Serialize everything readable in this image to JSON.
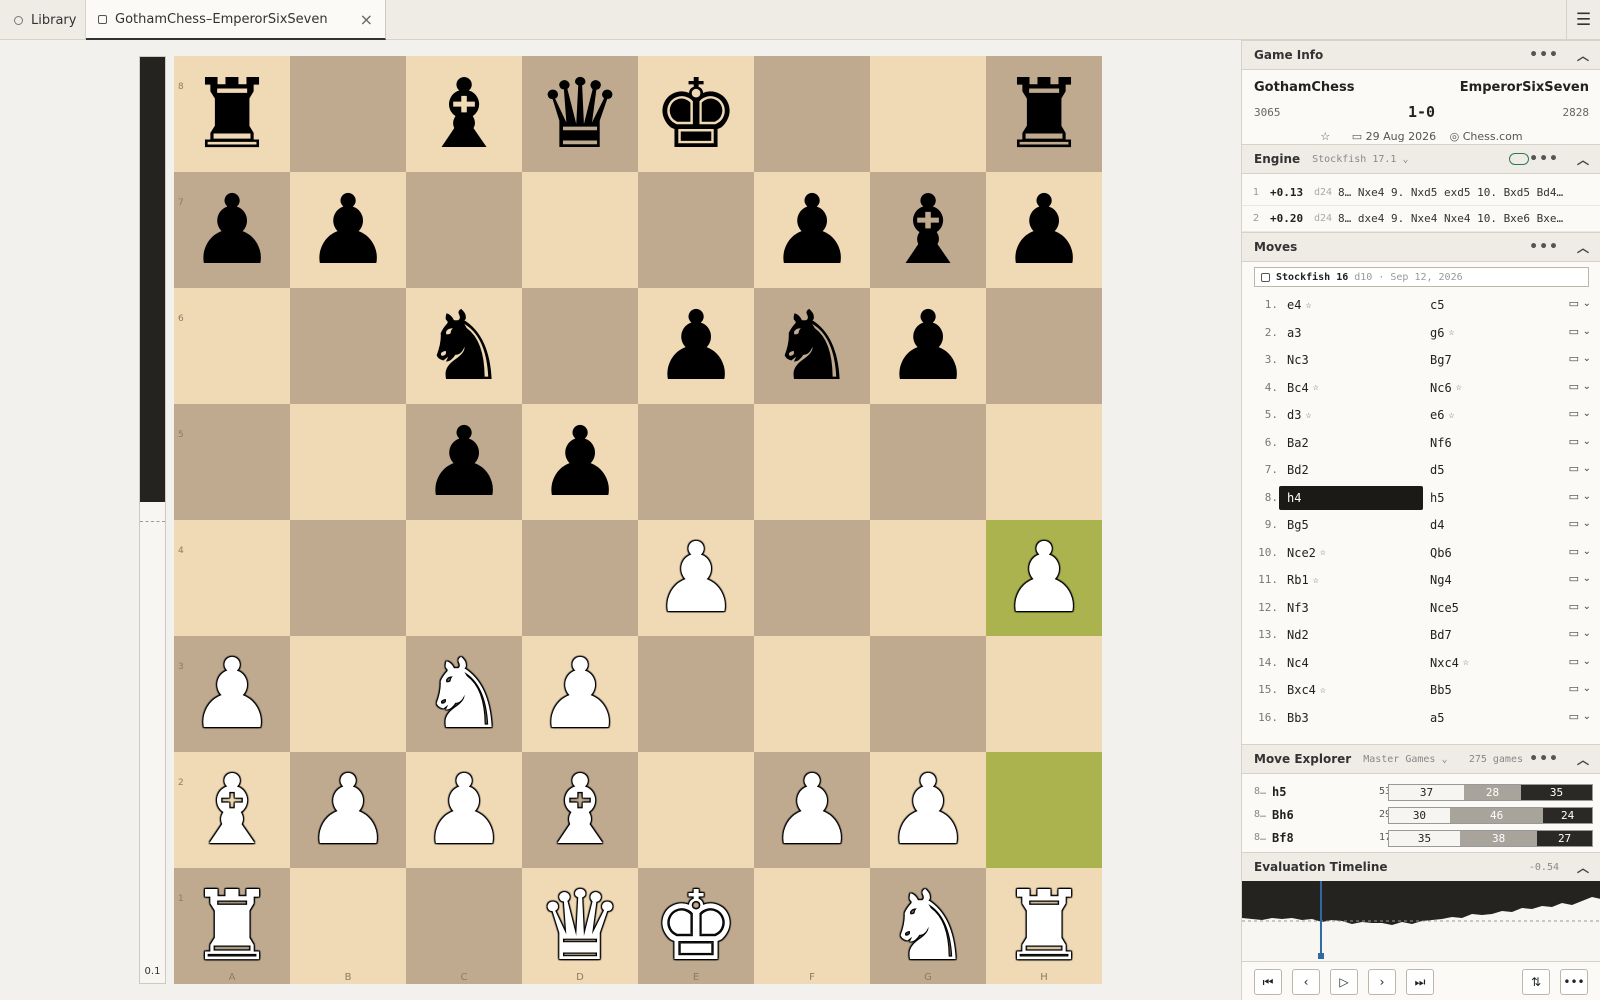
{
  "tabs": {
    "library_label": "Library",
    "game_label": "GothamChess–EmperorSixSeven"
  },
  "eval_bar": {
    "value": "0.1",
    "black_fraction": 0.48
  },
  "board": {
    "rank_labels": [
      "8",
      "7",
      "6",
      "5",
      "4",
      "3",
      "2",
      "1"
    ],
    "file_labels": [
      "A",
      "B",
      "C",
      "D",
      "E",
      "F",
      "G",
      "H"
    ],
    "highlight_squares": [
      "h4",
      "h2"
    ],
    "pieces": [
      {
        "sq": "a8",
        "glyph": "♜",
        "color": "black"
      },
      {
        "sq": "c8",
        "glyph": "♝",
        "color": "black"
      },
      {
        "sq": "d8",
        "glyph": "♛",
        "color": "black"
      },
      {
        "sq": "e8",
        "glyph": "♚",
        "color": "black"
      },
      {
        "sq": "h8",
        "glyph": "♜",
        "color": "black"
      },
      {
        "sq": "a7",
        "glyph": "♟",
        "color": "black"
      },
      {
        "sq": "b7",
        "glyph": "♟",
        "color": "black"
      },
      {
        "sq": "f7",
        "glyph": "♟",
        "color": "black"
      },
      {
        "sq": "g7",
        "glyph": "♝",
        "color": "black"
      },
      {
        "sq": "h7",
        "glyph": "♟",
        "color": "black"
      },
      {
        "sq": "c6",
        "glyph": "♞",
        "color": "black"
      },
      {
        "sq": "e6",
        "glyph": "♟",
        "color": "black"
      },
      {
        "sq": "f6",
        "glyph": "♞",
        "color": "black"
      },
      {
        "sq": "g6",
        "glyph": "♟",
        "color": "black"
      },
      {
        "sq": "c5",
        "glyph": "♟",
        "color": "black"
      },
      {
        "sq": "d5",
        "glyph": "♟",
        "color": "black"
      },
      {
        "sq": "e4",
        "glyph": "♟",
        "color": "white"
      },
      {
        "sq": "h4",
        "glyph": "♟",
        "color": "white"
      },
      {
        "sq": "a3",
        "glyph": "♟",
        "color": "white"
      },
      {
        "sq": "c3",
        "glyph": "♞",
        "color": "white"
      },
      {
        "sq": "d3",
        "glyph": "♟",
        "color": "white"
      },
      {
        "sq": "a2",
        "glyph": "♝",
        "color": "white"
      },
      {
        "sq": "b2",
        "glyph": "♟",
        "color": "white"
      },
      {
        "sq": "c2",
        "glyph": "♟",
        "color": "white"
      },
      {
        "sq": "d2",
        "glyph": "♝",
        "color": "white"
      },
      {
        "sq": "f2",
        "glyph": "♟",
        "color": "white"
      },
      {
        "sq": "g2",
        "glyph": "♟",
        "color": "white"
      },
      {
        "sq": "a1",
        "glyph": "♜",
        "color": "white"
      },
      {
        "sq": "d1",
        "glyph": "♛",
        "color": "white"
      },
      {
        "sq": "e1",
        "glyph": "♚",
        "color": "white"
      },
      {
        "sq": "g1",
        "glyph": "♞",
        "color": "white"
      },
      {
        "sq": "h1",
        "glyph": "♜",
        "color": "white"
      }
    ]
  },
  "game_info": {
    "title": "Game Info",
    "white_name": "GothamChess",
    "black_name": "EmperorSixSeven",
    "white_elo": "3065",
    "black_elo": "2828",
    "result": "1-0",
    "date": "29 Aug 2026",
    "site": "Chess.com"
  },
  "engine": {
    "title": "Engine",
    "name": "Stockfish 17.1",
    "lines": [
      {
        "idx": "1",
        "score": "+0.13",
        "depth": "d24",
        "pv": "8… Nxe4 9. Nxd5 exd5 10. Bxd5 Bd4…"
      },
      {
        "idx": "2",
        "score": "+0.20",
        "depth": "d24",
        "pv": "8… dxe4 9. Nxe4 Nxe4 10. Bxe6 Bxe…"
      }
    ]
  },
  "moves": {
    "title": "Moves",
    "annotation_engine": "Stockfish 16",
    "annotation_detail": "d10 · Sep 12, 2026",
    "rows": [
      {
        "n": "1.",
        "w": "e4",
        "ws": true,
        "b": "c5",
        "bs": false
      },
      {
        "n": "2.",
        "w": "a3",
        "ws": false,
        "b": "g6",
        "bs": true
      },
      {
        "n": "3.",
        "w": "Nc3",
        "ws": false,
        "b": "Bg7",
        "bs": false
      },
      {
        "n": "4.",
        "w": "Bc4",
        "ws": true,
        "b": "Nc6",
        "bs": true
      },
      {
        "n": "5.",
        "w": "d3",
        "ws": true,
        "b": "e6",
        "bs": true
      },
      {
        "n": "6.",
        "w": "Ba2",
        "ws": false,
        "b": "Nf6",
        "bs": false
      },
      {
        "n": "7.",
        "w": "Bd2",
        "ws": false,
        "b": "d5",
        "bs": false
      },
      {
        "n": "8.",
        "w": "h4",
        "ws": false,
        "b": "h5",
        "bs": false,
        "active": true
      },
      {
        "n": "9.",
        "w": "Bg5",
        "ws": false,
        "b": "d4",
        "bs": false
      },
      {
        "n": "10.",
        "w": "Nce2",
        "ws": true,
        "b": "Qb6",
        "bs": false
      },
      {
        "n": "11.",
        "w": "Rb1",
        "ws": true,
        "b": "Ng4",
        "bs": false
      },
      {
        "n": "12.",
        "w": "Nf3",
        "ws": false,
        "b": "Nce5",
        "bs": false
      },
      {
        "n": "13.",
        "w": "Nd2",
        "ws": false,
        "b": "Bd7",
        "bs": false
      },
      {
        "n": "14.",
        "w": "Nc4",
        "ws": false,
        "b": "Nxc4",
        "bs": true
      },
      {
        "n": "15.",
        "w": "Bxc4",
        "ws": true,
        "b": "Bb5",
        "bs": false
      },
      {
        "n": "16.",
        "w": "Bb3",
        "ws": false,
        "b": "a5",
        "bs": false
      }
    ]
  },
  "explorer": {
    "title": "Move Explorer",
    "source": "Master Games",
    "games_count": "275 games",
    "rows": [
      {
        "n": "8…",
        "move": "h5",
        "pct": "53%",
        "w": 37,
        "d": 28,
        "b": 35
      },
      {
        "n": "8…",
        "move": "Bh6",
        "pct": "29%",
        "w": 30,
        "d": 46,
        "b": 24
      },
      {
        "n": "8…",
        "move": "Bf8",
        "pct": "17%",
        "w": 35,
        "d": 38,
        "b": 27
      }
    ]
  },
  "timeline": {
    "title": "Evaluation Timeline",
    "value": "-0.54",
    "marker_fraction": 0.22
  }
}
